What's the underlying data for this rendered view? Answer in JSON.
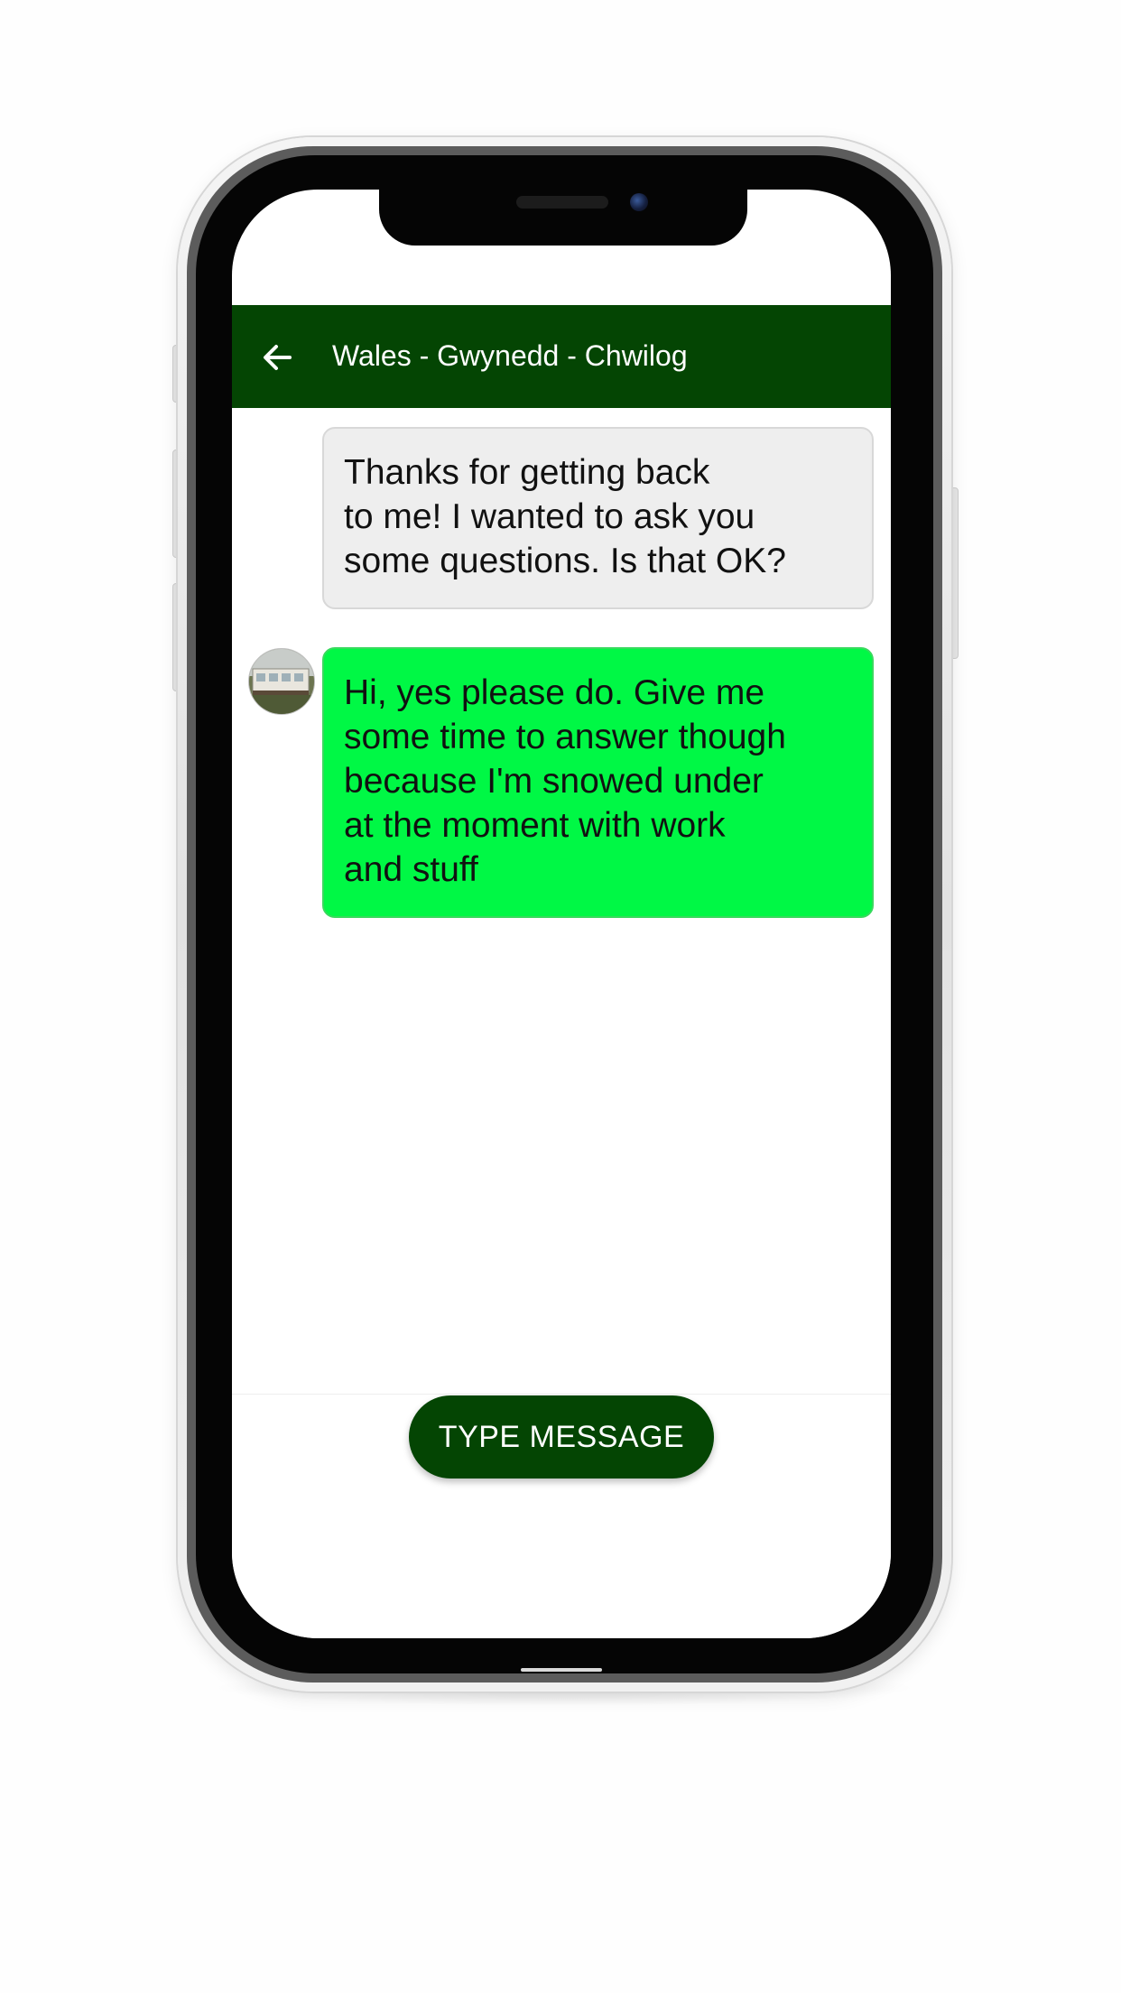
{
  "app": {
    "header": {
      "title": "Wales - Gwynedd - Chwilog",
      "back_icon": "arrow-left-icon"
    },
    "messages": [
      {
        "direction": "outgoing",
        "text": "Thanks for getting back\nto me! I wanted to ask you\nsome questions. Is that OK?"
      },
      {
        "direction": "incoming",
        "avatar": "caravan-photo-avatar",
        "text": "Hi, yes please do. Give me\nsome time to answer though\nbecause I'm snowed under\nat the moment with work\nand stuff"
      }
    ],
    "composer": {
      "button_label": "TYPE MESSAGE"
    }
  },
  "colors": {
    "header_bg": "#044503",
    "incoming_bubble": "#00f845",
    "outgoing_bubble": "#eeeeee",
    "button_bg": "#044503"
  }
}
